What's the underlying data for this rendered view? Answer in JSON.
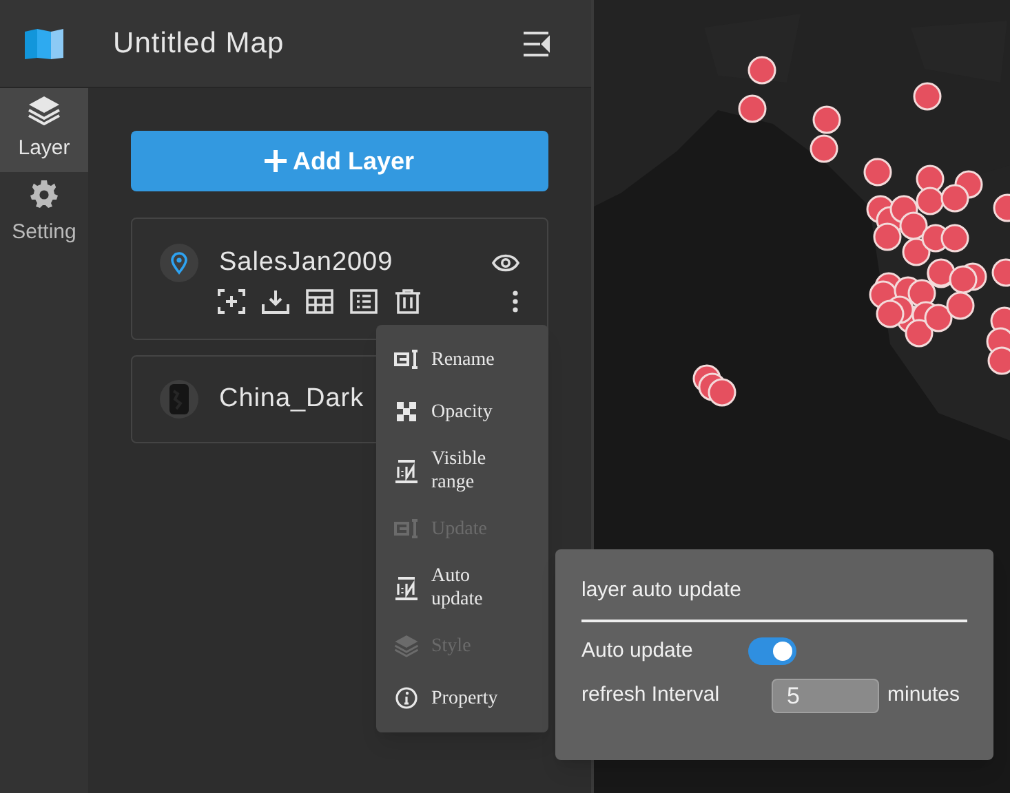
{
  "header": {
    "title": "Untitled Map"
  },
  "nav": [
    {
      "label": "Layer",
      "kind": "layers",
      "selected": true
    },
    {
      "label": "Setting",
      "kind": "gear",
      "selected": false
    }
  ],
  "add_button": {
    "label": "Add Layer"
  },
  "layers": [
    {
      "name": "SalesJan2009",
      "kind": "point",
      "expanded": true
    },
    {
      "name": "China_Dark",
      "kind": "raster",
      "expanded": false
    }
  ],
  "menu": [
    {
      "label": "Rename",
      "kind": "rename",
      "disabled": false
    },
    {
      "label": "Opacity",
      "kind": "opacity",
      "disabled": false
    },
    {
      "label": "Visible range",
      "kind": "range",
      "disabled": false
    },
    {
      "label": "Update",
      "kind": "rename",
      "disabled": true
    },
    {
      "label": "Auto update",
      "kind": "range",
      "disabled": false
    },
    {
      "label": "Style",
      "kind": "layers",
      "disabled": true
    },
    {
      "label": "Property",
      "kind": "info",
      "disabled": false
    }
  ],
  "auto_update_panel": {
    "title": "layer auto update",
    "toggle_label": "Auto update",
    "on": true,
    "interval_label": "refresh Interval",
    "interval_value": "5",
    "unit": "minutes"
  }
}
